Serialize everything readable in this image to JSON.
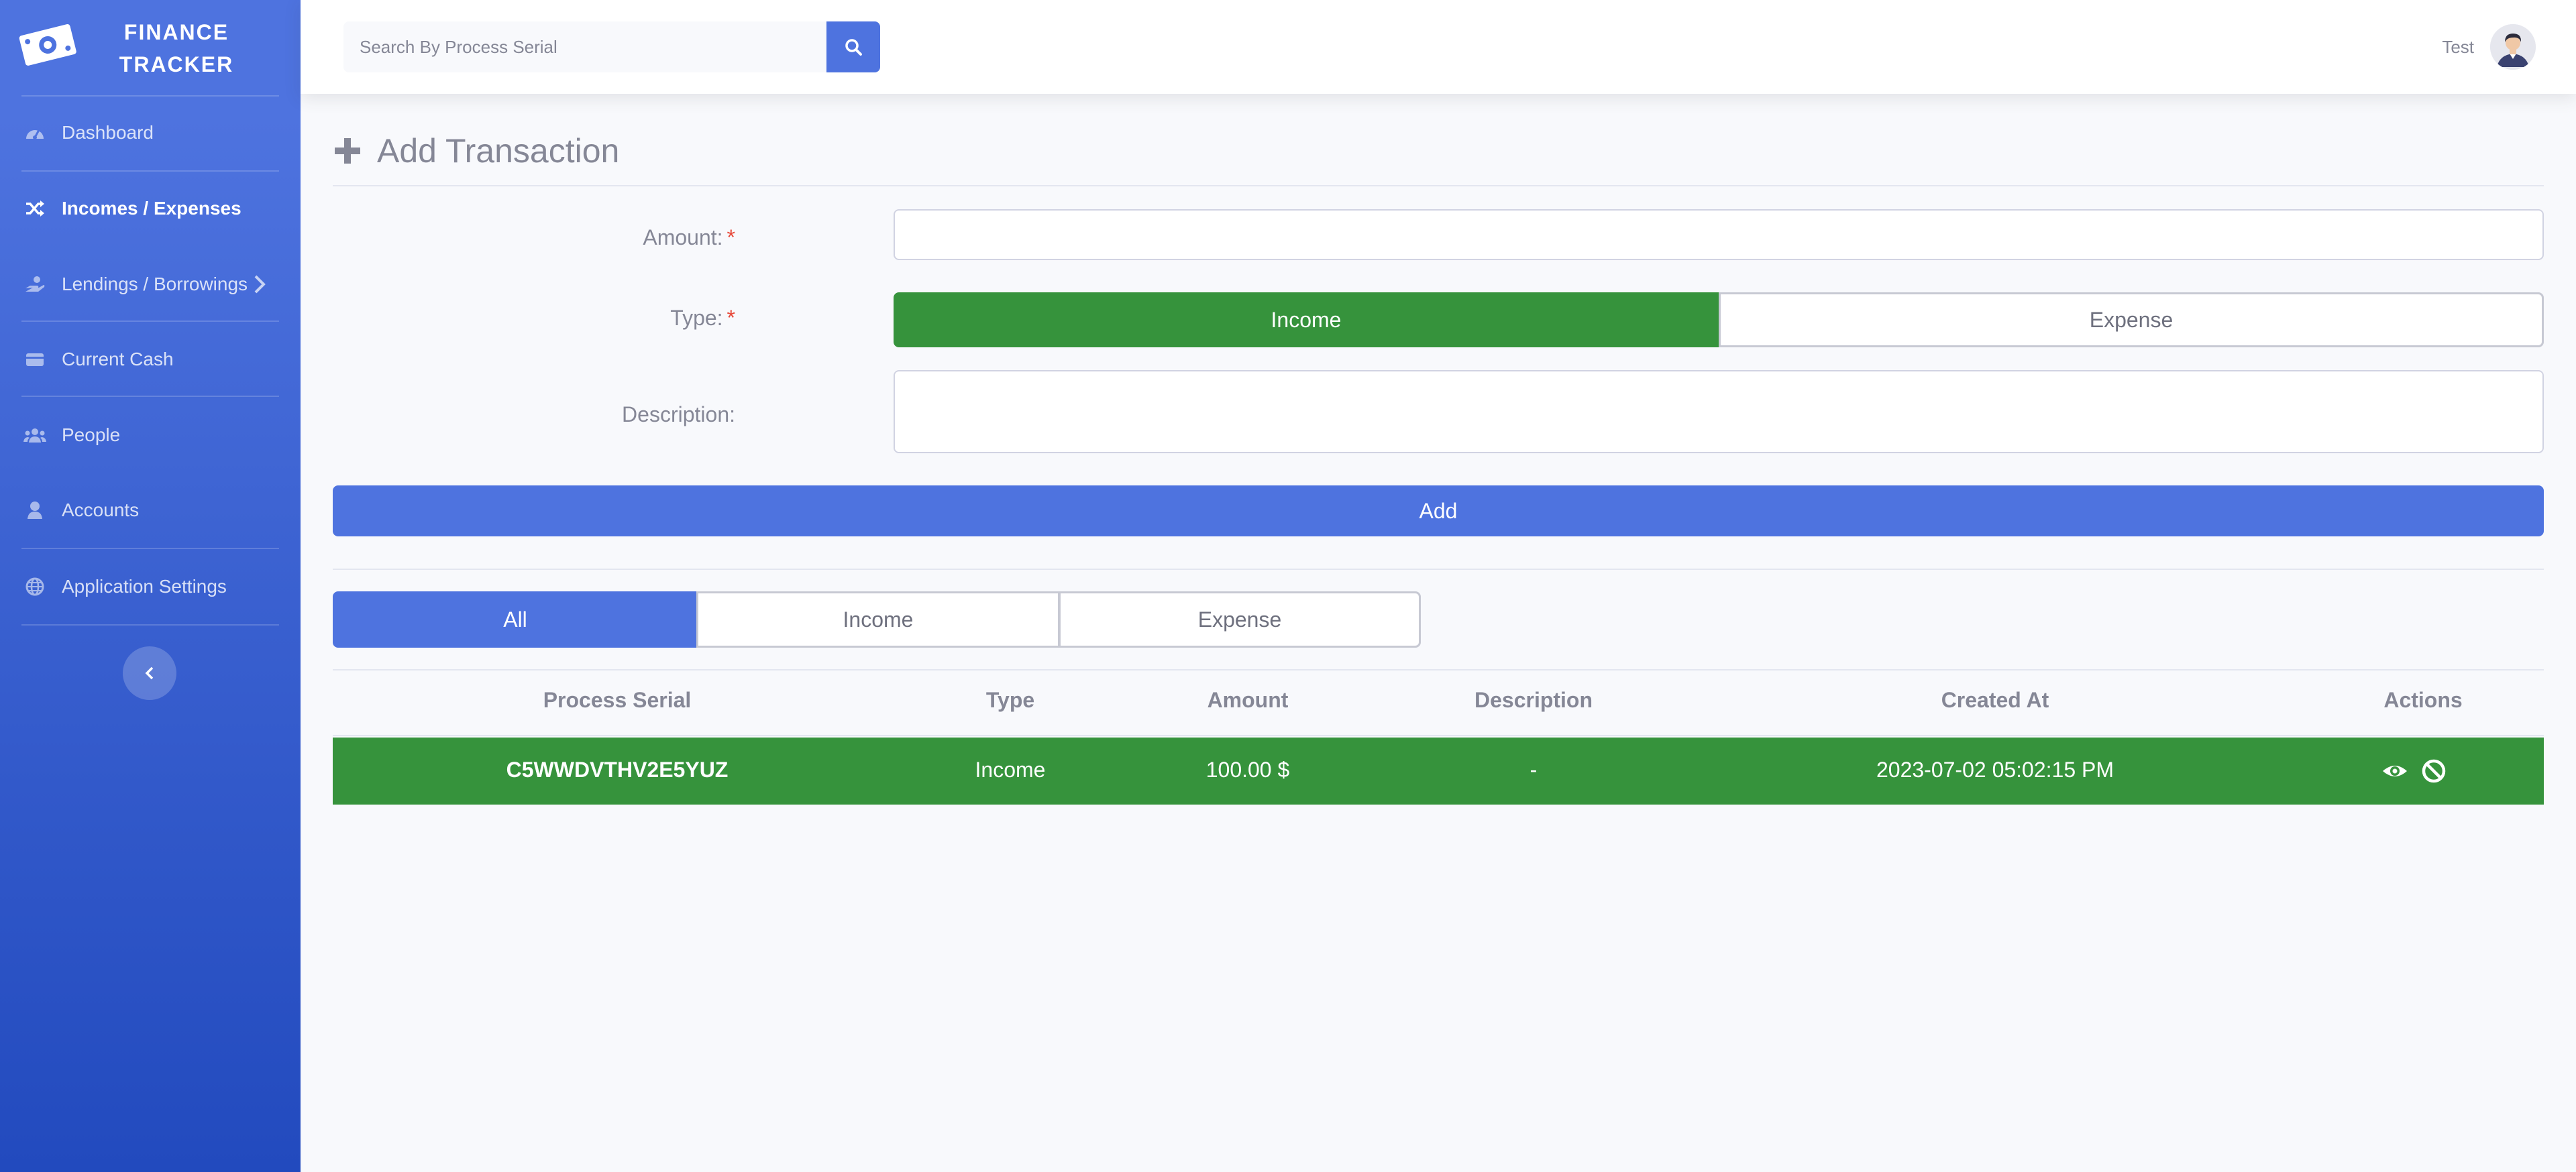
{
  "brand": {
    "line1": "FINANCE",
    "line2": "TRACKER"
  },
  "sidebar": {
    "items": [
      {
        "label": "Dashboard",
        "icon": "gauge-icon"
      },
      {
        "label": "Incomes / Expenses",
        "icon": "shuffle-icon",
        "active": true
      },
      {
        "label": "Lendings / Borrowings",
        "icon": "hand-holding-icon",
        "has_submenu": true
      },
      {
        "label": "Current Cash",
        "icon": "wallet-icon"
      },
      {
        "label": "People",
        "icon": "users-icon"
      },
      {
        "label": "Accounts",
        "icon": "user-icon"
      },
      {
        "label": "Application Settings",
        "icon": "globe-icon"
      }
    ]
  },
  "topbar": {
    "search_placeholder": "Search By Process Serial",
    "user_name": "Test"
  },
  "page": {
    "title": "Add Transaction"
  },
  "form": {
    "amount_label": "Amount:",
    "amount_value": "",
    "type_label": "Type:",
    "required_mark": "*",
    "type_options": [
      "Income",
      "Expense"
    ],
    "type_selected": "Income",
    "description_label": "Description:",
    "description_value": "",
    "add_label": "Add"
  },
  "filters": {
    "options": [
      "All",
      "Income",
      "Expense"
    ],
    "selected": "All"
  },
  "table": {
    "headers": [
      "Process Serial",
      "Type",
      "Amount",
      "Description",
      "Created At",
      "Actions"
    ],
    "rows": [
      {
        "serial": "C5WWDVTHV2E5YUZ",
        "type": "Income",
        "amount": "100.00 $",
        "description": "-",
        "created_at": "2023-07-02 05:02:15 PM"
      }
    ]
  },
  "colors": {
    "primary": "#4e73df",
    "income": "#36933c",
    "danger": "#e74a3b"
  }
}
